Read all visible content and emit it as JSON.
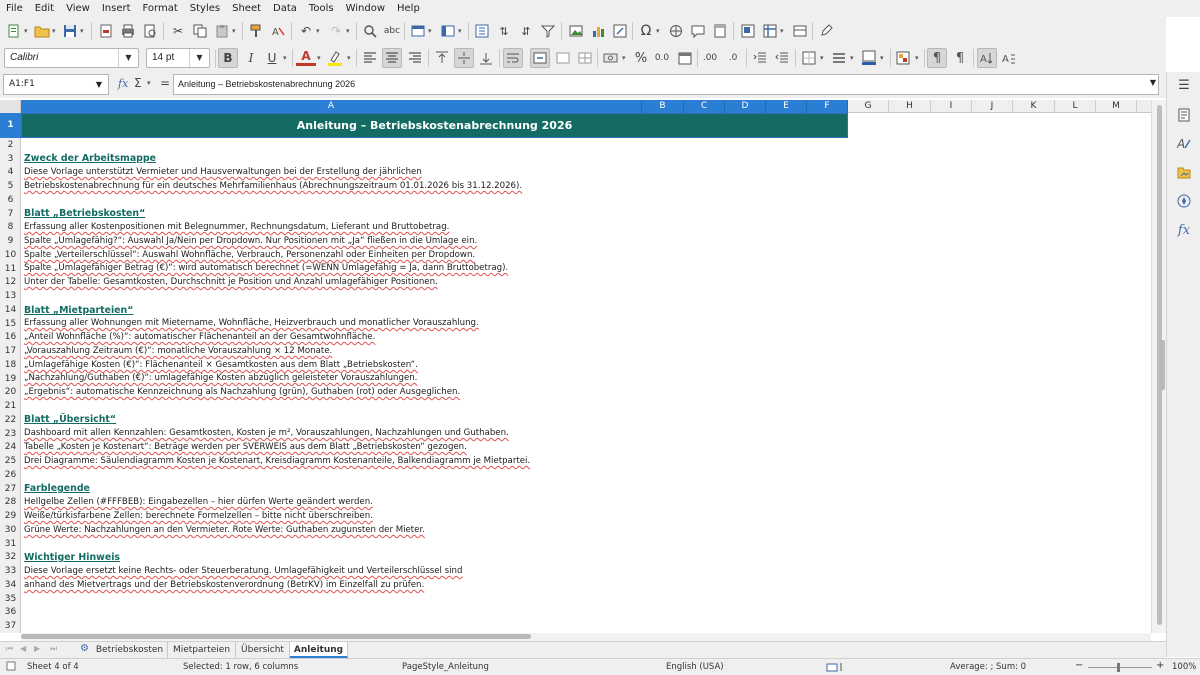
{
  "menu": [
    "File",
    "Edit",
    "View",
    "Insert",
    "Format",
    "Styles",
    "Sheet",
    "Data",
    "Tools",
    "Window",
    "Help"
  ],
  "toolbar": {
    "font_name": "Calibri",
    "font_size": "14 pt",
    "bold_label": "B",
    "italic_label": "I",
    "underline_label": "U",
    "font_color_label": "A",
    "currency_label": "%",
    "decimal_label": "0.0",
    "add_decimal_label": ".00",
    "remove_decimal_label": ".0"
  },
  "formula_bar": {
    "name_box": "A1:F1",
    "fx_label": "fx",
    "sum_label": "Σ",
    "equals_label": "=",
    "content": "Anleitung – Betriebskostenabrechnung 2026"
  },
  "columns": [
    "A",
    "B",
    "C",
    "D",
    "E",
    "F",
    "G",
    "H",
    "I",
    "J",
    "K",
    "L",
    "M"
  ],
  "rows": [
    "1",
    "2",
    "3",
    "4",
    "5",
    "6",
    "7",
    "8",
    "9",
    "10",
    "11",
    "12",
    "13",
    "14",
    "15",
    "16",
    "17",
    "18",
    "19",
    "20",
    "21",
    "22",
    "23",
    "24",
    "25",
    "26",
    "27",
    "28",
    "29",
    "30",
    "31",
    "32",
    "33",
    "34",
    "35",
    "36",
    "37"
  ],
  "sheet": {
    "title": "Anleitung – Betriebskostenabrechnung 2026",
    "r3": "Zweck der Arbeitsmappe",
    "r4": "Diese Vorlage unterstützt Vermieter und Hausverwaltungen bei der Erstellung der jährlichen",
    "r5": "Betriebskostenabrechnung für ein deutsches Mehrfamilienhaus (Abrechnungszeitraum 01.01.2026 bis 31.12.2026).",
    "r7": "Blatt „Betriebskosten“",
    "r8": "Erfassung aller Kostenpositionen mit Belegnummer, Rechnungsdatum, Lieferant und Bruttobetrag.",
    "r9": "Spalte „Umlagefähig?“: Auswahl Ja/Nein per Dropdown. Nur Positionen mit „Ja“ fließen in die Umlage ein.",
    "r10": "Spalte „Verteilerschlüssel“: Auswahl Wohnfläche, Verbrauch, Personenzahl oder Einheiten per Dropdown.",
    "r11": "Spalte „Umlagefähiger Betrag (€)“: wird automatisch berechnet (=WENN Umlagefähig = Ja, dann Bruttobetrag).",
    "r12": "Unter der Tabelle: Gesamtkosten, Durchschnitt je Position und Anzahl umlagefähiger Positionen.",
    "r14": "Blatt „Mietparteien“",
    "r15": "Erfassung aller Wohnungen mit Mietername, Wohnfläche, Heizverbrauch und monatlicher Vorauszahlung.",
    "r16": "„Anteil Wohnfläche (%)“: automatischer Flächenanteil an der Gesamtwohnfläche.",
    "r17": "„Vorauszahlung Zeitraum (€)“: monatliche Vorauszahlung × 12 Monate.",
    "r18": "„Umlagefähige Kosten (€)“: Flächenanteil × Gesamtkosten aus dem Blatt „Betriebskosten“.",
    "r19": "„Nachzahlung/Guthaben (€)“: umlagefähige Kosten abzüglich geleisteter Vorauszahlungen.",
    "r20": "„Ergebnis“: automatische Kennzeichnung als Nachzahlung (grün), Guthaben (rot) oder Ausgeglichen.",
    "r22": "Blatt „Übersicht“",
    "r23": "Dashboard mit allen Kennzahlen: Gesamtkosten, Kosten je m², Vorauszahlungen, Nachzahlungen und Guthaben.",
    "r24": "Tabelle „Kosten je Kostenart“: Beträge werden per SVERWEIS aus dem Blatt „Betriebskosten“ gezogen.",
    "r25": "Drei Diagramme: Säulendiagramm Kosten je Kostenart, Kreisdiagramm Kostenanteile, Balkendiagramm je Mietpartei.",
    "r27": "Farblegende",
    "r28": "Hellgelbe Zellen (#FFFBEB): Eingabezellen – hier dürfen Werte geändert werden.",
    "r29": "Weiße/türkisfarbene Zellen: berechnete Formelzellen – bitte nicht überschreiben.",
    "r30": "Grüne Werte: Nachzahlungen an den Vermieter. Rote Werte: Guthaben zugunsten der Mieter.",
    "r32": "Wichtiger Hinweis",
    "r33": "Diese Vorlage ersetzt keine Rechts- oder Steuerberatung. Umlagefähigkeit und Verteilerschlüssel sind",
    "r34": "anhand des Mietvertrags und der Betriebskostenverordnung (BetrKV) im Einzelfall zu prüfen."
  },
  "tabs": [
    "Betriebskosten",
    "Mietparteien",
    "Übersicht",
    "Anleitung"
  ],
  "active_tab": "Anleitung",
  "status": {
    "sheet": "Sheet 4 of 4",
    "selection": "Selected: 1 row, 6 columns",
    "page_style": "PageStyle_Anleitung",
    "language": "English (USA)",
    "stats": "Average: ; Sum: 0",
    "zoom": "100%"
  },
  "colors": {
    "header_teal": "#136b63",
    "selection_blue": "#2a7fd4",
    "spell_red": "#e05050"
  }
}
